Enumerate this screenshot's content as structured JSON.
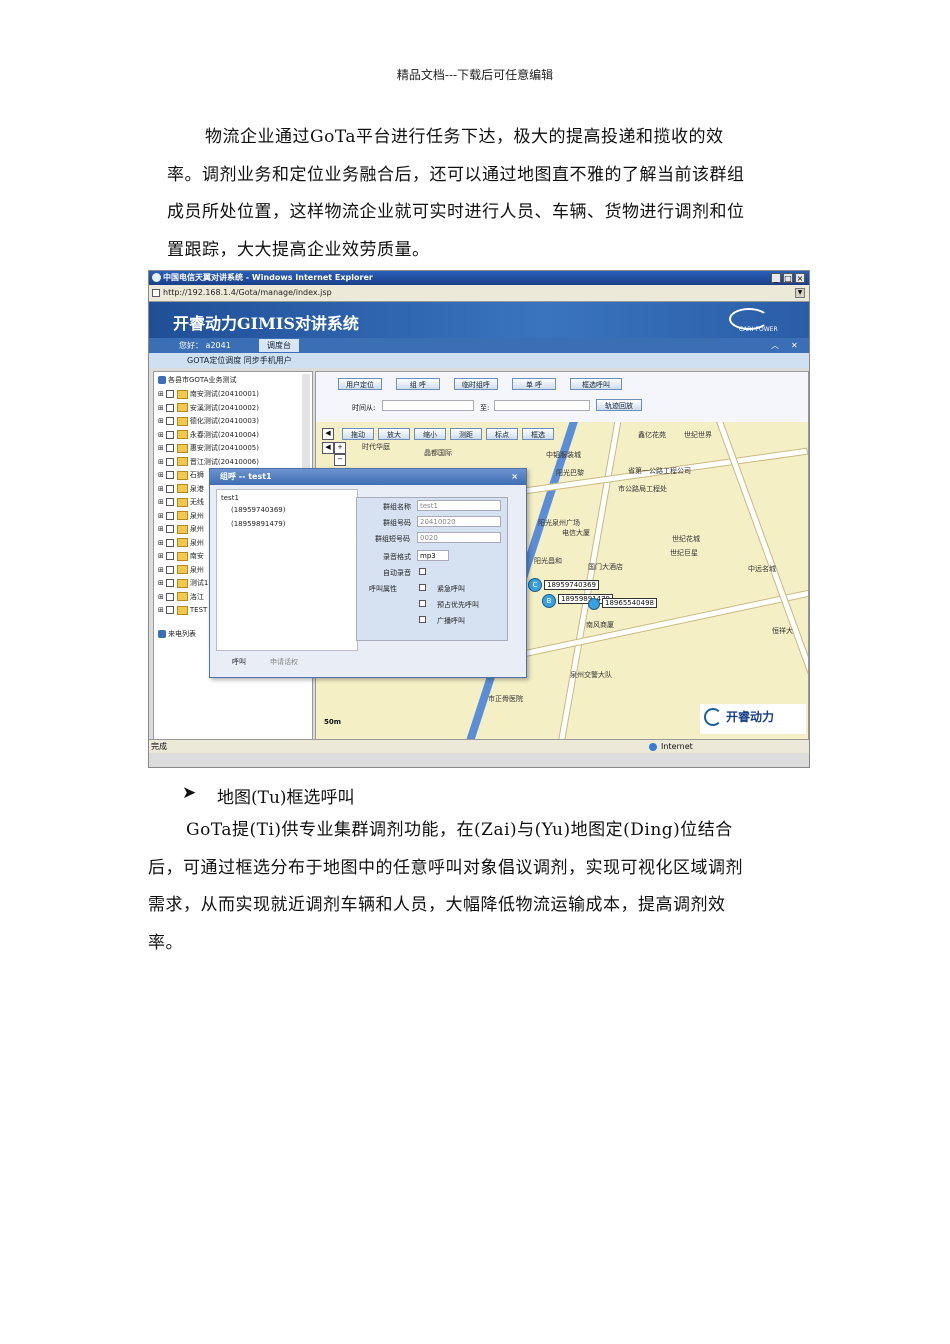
{
  "header_note": "精品文档---下载后可任意编辑",
  "paragraph1": [
    "物流企业通过GoTa平台进行任务下达，极大的提高投递和揽收的效",
    "率。调剂业务和定位业务融合后，还可以通过地图直不雅的了解当前该群组",
    "成员所处位置，这样物流企业就可实时进行人员、车辆、货物进行调剂和位",
    "置跟踪，大大提高企业效劳质量。"
  ],
  "screenshot": {
    "window_title": "中国电信天翼对讲系统 - Windows Internet Explorer",
    "address": "http://192.168.1.4/Gota/manage/index.jsp",
    "app_title": "开睿动力GIMIS对讲系统",
    "brand_small": "CARI-POWER",
    "user_label": "您好：  a2041",
    "tab_dispatch": "调度台",
    "subnav": "GOTA定位调度  同步手机用户",
    "tree_root": "各县市GOTA业务测试",
    "tree_items": [
      "南安测试(20410001)",
      "安溪测试(20410002)",
      "德化测试(20410003)",
      "永春测试(20410004)",
      "惠安测试(20410005)",
      "晋江测试(20410006)",
      "石狮",
      "泉港",
      "无线",
      "泉州",
      "泉州",
      "泉州",
      "南安",
      "泉州",
      "测试1",
      "洛江",
      "TEST"
    ],
    "call_list": "来电列表",
    "buttons": [
      "用户定位",
      "组  呼",
      "临时组呼",
      "单  呼",
      "框选呼叫"
    ],
    "time_from": "时间从:",
    "time_to": "至:",
    "track_button": "轨迹回放",
    "map_tools": [
      "拖动",
      "放大",
      "缩小",
      "测距",
      "标点",
      "框选"
    ],
    "map_labels": [
      "时代华庭",
      "晶都国际",
      "中韬服装城",
      "省第一公路工程公司",
      "市公路局工程处",
      "鑫亿花苑",
      "世纪花城",
      "世纪巨星",
      "中远名城",
      "阳光昌和",
      "电信大厦",
      "国门大酒店",
      "阳光泉州广场",
      "南风商厦",
      "泉州交警大队",
      "市正骨医院",
      "恒祥大",
      "阳光巴黎",
      "世纪世界"
    ],
    "markers": [
      {
        "letter": "C",
        "phone": "18959740369"
      },
      {
        "letter": "B",
        "phone": "18959891479"
      },
      {
        "letter": "",
        "phone": "18965540498"
      }
    ],
    "scale": "50m",
    "map_brand": "开睿动力",
    "dialog": {
      "title": "组呼 -- test1",
      "tree_root": "test1",
      "members": [
        "(18959740369)",
        "(18959891479)"
      ],
      "group_name_label": "群组名称",
      "group_name_value": "test1",
      "group_no_label": "群组号码",
      "group_no_value": "20410020",
      "short_no_label": "群组短号码",
      "short_no_value": "0020",
      "record_format_label": "录音格式",
      "record_format_value": "mp3",
      "auto_record_label": "自动录音",
      "call_attr_label": "呼叫属性",
      "attr_options": [
        "紧急呼叫",
        "预占优先呼叫",
        "广播呼叫"
      ],
      "call_button": "呼叫",
      "apply_button": "申请话权"
    },
    "status_left": "完成",
    "status_right": "Internet"
  },
  "bullet_heading": "地图(Tu)框选呼叫",
  "paragraph2": [
    "GoTa提(Ti)供专业集群调剂功能，在(Zai)与(Yu)地图定(Ding)位结合",
    "后，可通过框选分布于地图中的任意呼叫对象倡议调剂，实现可视化区域调剂",
    "需求，从而实现就近调剂车辆和人员，大幅降低物流运输成本，提高调剂效",
    "率。"
  ]
}
